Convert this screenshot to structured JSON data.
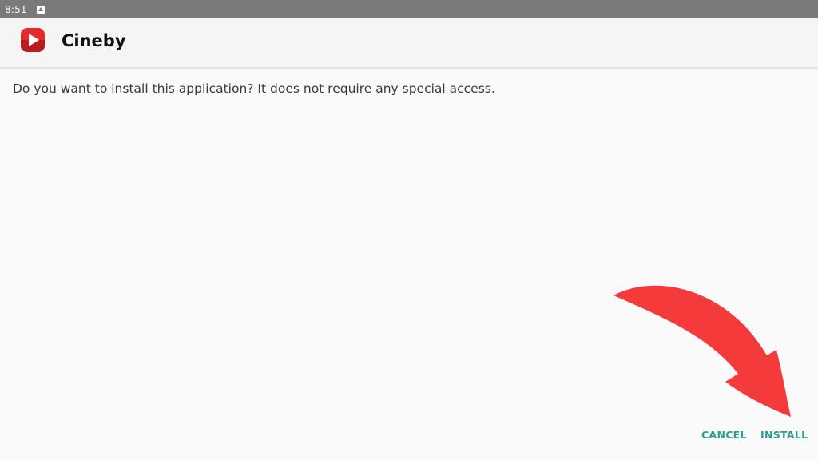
{
  "status_bar": {
    "time": "8:51",
    "notification_icon": "download-notification-icon"
  },
  "header": {
    "app_icon": "play-app-icon",
    "app_name": "Cineby"
  },
  "dialog": {
    "message": "Do you want to install this application? It does not require any special access."
  },
  "actions": {
    "cancel_label": "CANCEL",
    "install_label": "INSTALL"
  },
  "annotation": {
    "arrow_icon": "curved-arrow-icon",
    "arrow_color": "#f43a3a"
  },
  "colors": {
    "accent": "#2e9e8e",
    "status_bar": "#7a7a7a",
    "background": "#fafafa",
    "icon_red": "#e32b2b"
  }
}
